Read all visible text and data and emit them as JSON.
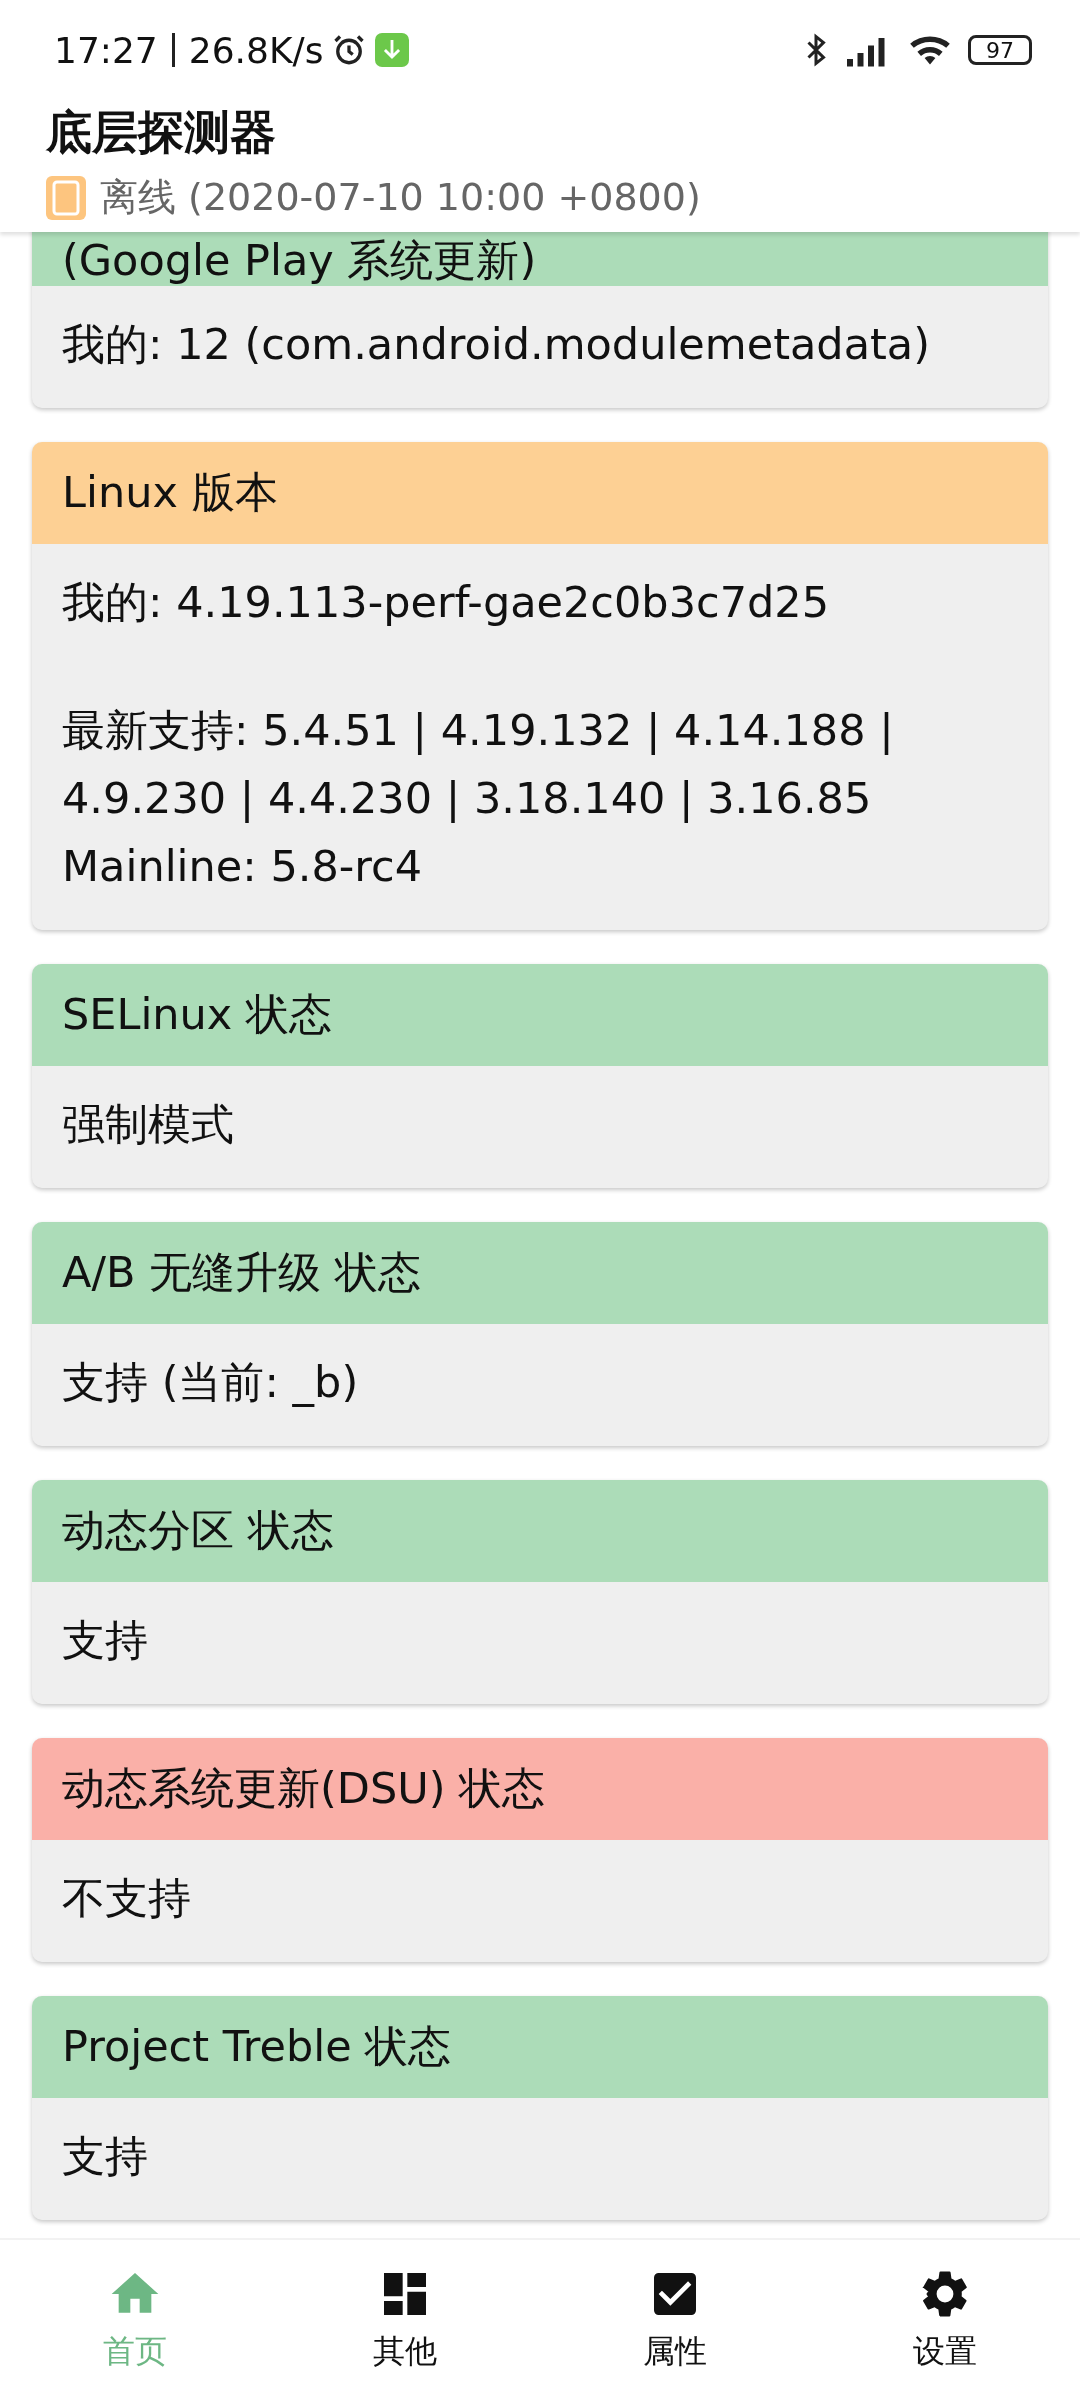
{
  "status_bar": {
    "time": "17:27",
    "speed": "26.8K/s",
    "battery": "97"
  },
  "app_bar": {
    "title": "底层探测器",
    "subtitle": "离线 (2020-07-10 10:00 +0800)"
  },
  "cards": [
    {
      "title": "(Google Play 系统更新)",
      "color": "#acdcb8",
      "paragraphs": [
        "我的: 12 (com.android.modulemetadata)"
      ]
    },
    {
      "title": "Linux 版本",
      "color": "#fdd094",
      "paragraphs": [
        "我的: 4.19.113-perf-gae2c0b3c7d25",
        "最新支持: 5.4.51 | 4.19.132 | 4.14.188 | 4.9.230 | 4.4.230 | 3.18.140 | 3.16.85\nMainline: 5.8-rc4"
      ]
    },
    {
      "title": "SELinux 状态",
      "color": "#acdcb8",
      "paragraphs": [
        "强制模式"
      ]
    },
    {
      "title": "A/B 无缝升级 状态",
      "color": "#acdcb8",
      "paragraphs": [
        "支持 (当前: _b)"
      ]
    },
    {
      "title": "动态分区 状态",
      "color": "#acdcb8",
      "paragraphs": [
        "支持"
      ]
    },
    {
      "title": "动态系统更新(DSU) 状态",
      "color": "#fab0a8",
      "paragraphs": [
        "不支持"
      ]
    },
    {
      "title": "Project Treble 状态",
      "color": "#acdcb8",
      "paragraphs": [
        "支持"
      ]
    }
  ],
  "bottom_nav": [
    {
      "label": "首页",
      "selected": true
    },
    {
      "label": "其他",
      "selected": false
    },
    {
      "label": "属性",
      "selected": false
    },
    {
      "label": "设置",
      "selected": false
    }
  ]
}
